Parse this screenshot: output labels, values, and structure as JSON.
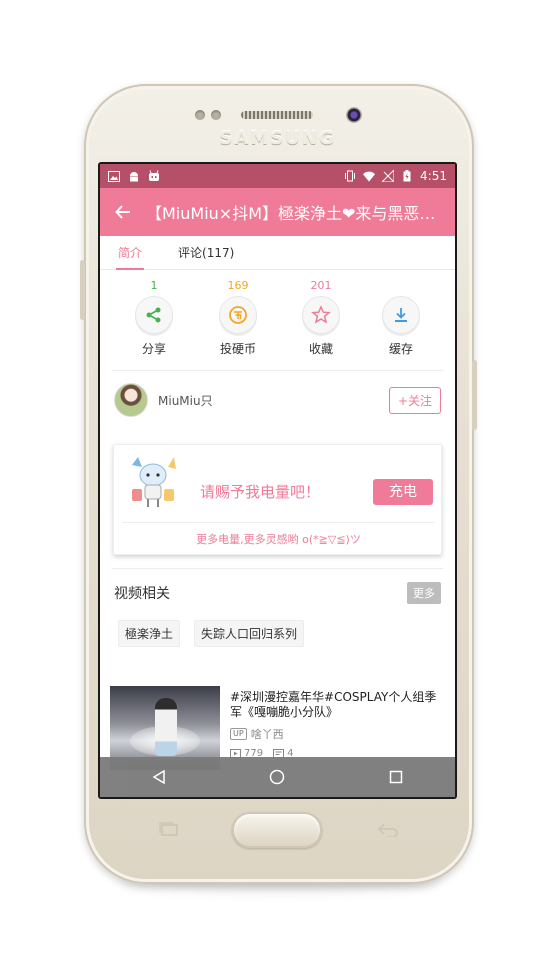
{
  "device": {
    "brand": "SAMSUNG"
  },
  "statusbar": {
    "time": "4:51"
  },
  "appbar": {
    "title": "【MiuMiu×抖M】極楽浄土❤来与黑恶势力跳舞吧"
  },
  "tabs": [
    {
      "label": "简介"
    },
    {
      "label": "评论(117)"
    }
  ],
  "actions": [
    {
      "count": "1",
      "label": "分享",
      "icon": "share-icon",
      "color": "#4caf50"
    },
    {
      "count": "169",
      "label": "投硬币",
      "icon": "coin-icon",
      "color": "#f5a623"
    },
    {
      "count": "201",
      "label": "收藏",
      "icon": "star-icon",
      "color": "#ef7b98"
    },
    {
      "count": "",
      "label": "缓存",
      "icon": "download-icon",
      "color": "#3d9be9"
    }
  ],
  "uploader": {
    "name": "MiuMiu只",
    "follow_label": "+关注"
  },
  "charge": {
    "text": "请赐予我电量吧！",
    "button_label": "充电",
    "subtext": "更多电量,更多灵感哟 o(*≧▽≦)ツ"
  },
  "related": {
    "title": "视频相关",
    "more_label": "更多",
    "tags": [
      "極楽浄土",
      "失踪人口回归系列"
    ]
  },
  "video": {
    "title": "#深圳漫控嘉年华#COSPLAY个人组季军《嘎嘣脆小分队》",
    "uploader": "啥丫西",
    "up_badge": "UP",
    "plays": "779",
    "danmaku": "4"
  },
  "colors": {
    "accent": "#ef7b98",
    "statusbar": "#b65069"
  }
}
